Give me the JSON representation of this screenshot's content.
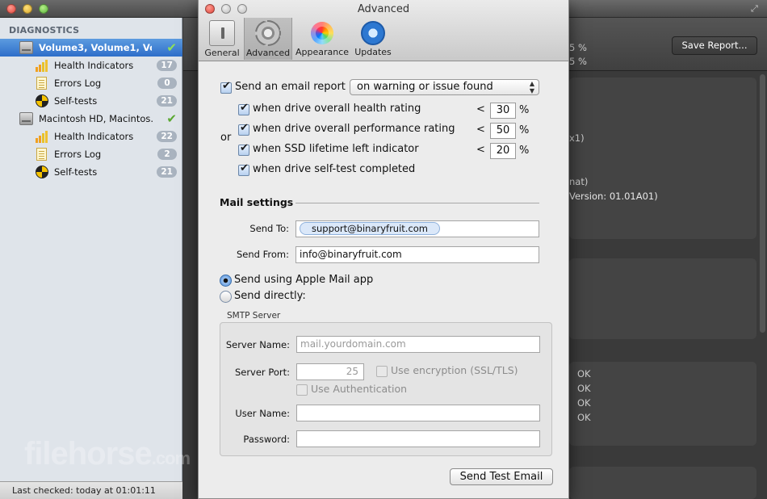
{
  "sidebar": {
    "header": "DIAGNOSTICS",
    "items": [
      {
        "label": "Volume3, Volume1, Vo...",
        "type": "drive",
        "selected": true,
        "icon": "hard-drive-icon",
        "status_icon": "checkmark-icon"
      },
      {
        "label": "Health Indicators",
        "type": "health",
        "badge": "17",
        "icon": "bar-chart-icon"
      },
      {
        "label": "Errors Log",
        "type": "log",
        "badge": "0",
        "icon": "log-document-icon"
      },
      {
        "label": "Self-tests",
        "type": "selftest",
        "badge": "21",
        "icon": "self-test-icon"
      },
      {
        "label": "Macintosh HD, Macintos...",
        "type": "drive",
        "selected": false,
        "icon": "hard-drive-icon",
        "status_icon": "checkmark-icon"
      },
      {
        "label": "Health Indicators",
        "type": "health",
        "badge": "22",
        "icon": "bar-chart-icon"
      },
      {
        "label": "Errors Log",
        "type": "log",
        "badge": "2",
        "icon": "log-document-icon"
      },
      {
        "label": "Self-tests",
        "type": "selftest",
        "badge": "21",
        "icon": "self-test-icon"
      }
    ],
    "status": "Last checked: today at 01:01:11"
  },
  "main": {
    "save_button": "Save Report...",
    "fragments": [
      "5 %",
      "5 %",
      "x1)",
      "nat)",
      "Version: 01.01A01)",
      "OK",
      "OK",
      "OK",
      "OK"
    ]
  },
  "watermark": {
    "text": "filehorse",
    "suffix": ".com"
  },
  "prefs": {
    "title": "Advanced",
    "toolbar": [
      {
        "label": "General",
        "icon": "general-switch-icon"
      },
      {
        "label": "Advanced",
        "icon": "gear-icon",
        "active": true
      },
      {
        "label": "Appearance",
        "icon": "color-wheel-icon"
      },
      {
        "label": "Updates",
        "icon": "updates-globe-icon"
      }
    ],
    "email_report": {
      "label": "Send an email report",
      "checked": true,
      "mode": "on warning or issue found"
    },
    "or_label": "or",
    "conditions": [
      {
        "label": "when drive overall health rating",
        "checked": true,
        "op": "<",
        "value": "30",
        "unit": "%"
      },
      {
        "label": "when drive overall performance rating",
        "checked": true,
        "op": "<",
        "value": "50",
        "unit": "%"
      },
      {
        "label": "when SSD lifetime left indicator",
        "checked": true,
        "op": "<",
        "value": "20",
        "unit": "%"
      },
      {
        "label": "when drive self-test completed",
        "checked": true
      }
    ],
    "mail_settings": {
      "title": "Mail settings",
      "send_to_label": "Send To:",
      "send_to_value": "support@binaryfruit.com",
      "send_from_label": "Send From:",
      "send_from_value": "info@binaryfruit.com",
      "radio_apple": "Send using Apple Mail app",
      "radio_direct": "Send directly:",
      "selected_method": "apple"
    },
    "smtp": {
      "title": "SMTP Server",
      "server_name_label": "Server Name:",
      "server_name_placeholder": "mail.yourdomain.com",
      "server_port_label": "Server Port:",
      "server_port_value": "25",
      "encryption_label": "Use encryption (SSL/TLS)",
      "auth_label": "Use Authentication",
      "user_name_label": "User Name:",
      "user_name_value": "",
      "password_label": "Password:",
      "password_value": ""
    },
    "test_button": "Send Test Email"
  }
}
